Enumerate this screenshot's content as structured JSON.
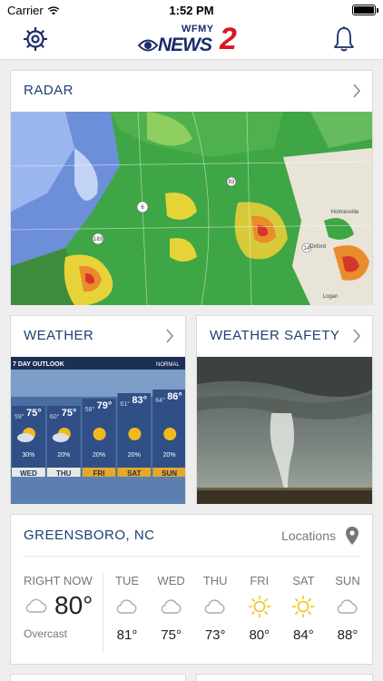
{
  "status_bar": {
    "carrier": "Carrier",
    "time": "1:52 PM",
    "battery_level": 1.0
  },
  "nav": {
    "logo_small": "WFMY",
    "logo_main": "NEWS",
    "logo_number": "2"
  },
  "cards": {
    "radar": {
      "title": "RADAR"
    },
    "weather": {
      "title": "WEATHER"
    },
    "safety": {
      "title": "WEATHER SAFETY"
    }
  },
  "weather_thumb": {
    "header": "7 DAY OUTLOOK",
    "badge": "NORMAL",
    "days": [
      {
        "hi": "75°",
        "lo": "59°",
        "pct": "30%",
        "day": "WED"
      },
      {
        "hi": "75°",
        "lo": "60°",
        "pct": "20%",
        "day": "THU"
      },
      {
        "hi": "79°",
        "lo": "58°",
        "pct": "20%",
        "day": "FRI"
      },
      {
        "hi": "83°",
        "lo": "61°",
        "pct": "20%",
        "day": "SAT"
      },
      {
        "hi": "86°",
        "lo": "64°",
        "pct": "20%",
        "day": "SUN"
      }
    ]
  },
  "radar_map": {
    "places": [
      "Oxford",
      "Logan",
      "Holmesville"
    ],
    "routes": [
      "14",
      "83",
      "183",
      "6",
      "34"
    ]
  },
  "forecast": {
    "city": "GREENSBORO, NC",
    "locations_label": "Locations",
    "now_label": "RIGHT NOW",
    "now_temp": "80°",
    "now_condition": "Overcast",
    "days": [
      {
        "name": "TUE",
        "temp": "81°",
        "icon": "cloud-icon"
      },
      {
        "name": "WED",
        "temp": "75°",
        "icon": "cloud-icon"
      },
      {
        "name": "THU",
        "temp": "73°",
        "icon": "cloud-icon"
      },
      {
        "name": "FRI",
        "temp": "80°",
        "icon": "sun-icon"
      },
      {
        "name": "SAT",
        "temp": "84°",
        "icon": "sun-icon"
      },
      {
        "name": "SUN",
        "temp": "88°",
        "icon": "cloud-icon"
      }
    ]
  },
  "colors": {
    "accent": "#1f3f73",
    "sun": "#f0c419",
    "brand_red": "#d71920",
    "icon_blue": "#1b2c6b"
  }
}
